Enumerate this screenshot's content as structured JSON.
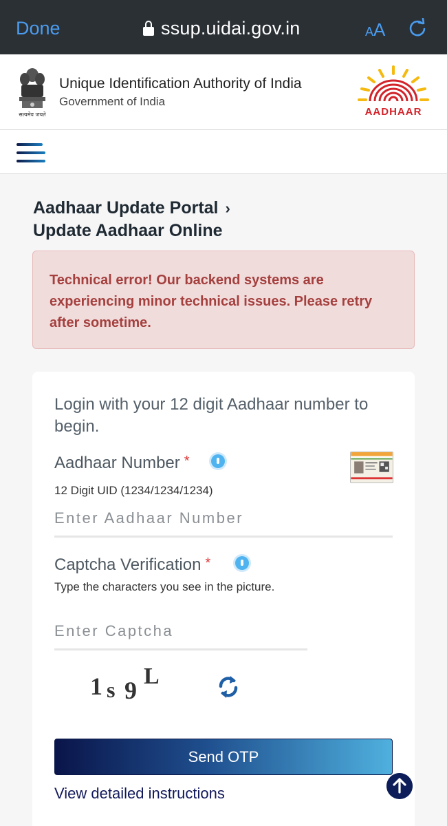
{
  "browser": {
    "done_label": "Done",
    "url": "ssup.uidai.gov.in",
    "text_size_small": "A",
    "text_size_large": "A"
  },
  "header": {
    "org_name": "Unique Identification Authority of India",
    "org_sub": "Government of India",
    "emblem_motto": "सत्यमेव जयते",
    "logo_text": "AADHAAR"
  },
  "breadcrumb": {
    "parent": "Aadhaar Update Portal",
    "separator": "›",
    "current": "Update Aadhaar Online"
  },
  "error": {
    "message": "Technical error! Our backend systems are experiencing minor technical issues. Please retry after sometime."
  },
  "form": {
    "intro": "Login with your 12 digit Aadhaar number to begin.",
    "aadhaar_label": "Aadhaar Number",
    "required_mark": "*",
    "aadhaar_hint": "12 Digit UID (1234/1234/1234)",
    "aadhaar_placeholder": "Enter Aadhaar Number",
    "aadhaar_value": "",
    "captcha_label": "Captcha Verification",
    "captcha_hint": "Type the characters you see in the picture.",
    "captcha_placeholder": "Enter Captcha",
    "captcha_value": "",
    "captcha_chars": [
      "1",
      "s",
      "9",
      "L"
    ],
    "send_otp_label": "Send OTP",
    "instructions_link": "View detailed instructions"
  },
  "colors": {
    "browser_bar": "#2b3035",
    "ios_blue": "#4a9cf0",
    "error_bg": "#f1dcdc",
    "error_text": "#a4403e",
    "button_start": "#0a154a",
    "button_end": "#4fb0de",
    "link": "#12195a"
  }
}
